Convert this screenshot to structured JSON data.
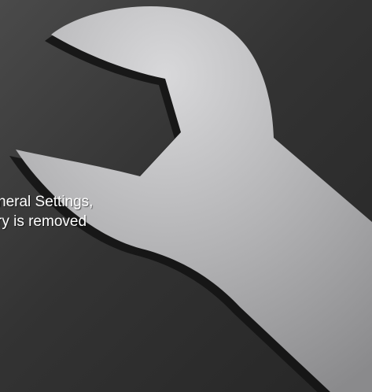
{
  "screen": {
    "text_lines": [
      "neral Settings,",
      "ry is removed"
    ],
    "icon": "wrench-icon",
    "colors": {
      "background_light": "#4a4a4a",
      "background_dark": "#262626",
      "wrench_light": "#d4d4d6",
      "wrench_dark": "#8c8c8e",
      "shadow": "#141414",
      "text": "#ffffff"
    }
  }
}
